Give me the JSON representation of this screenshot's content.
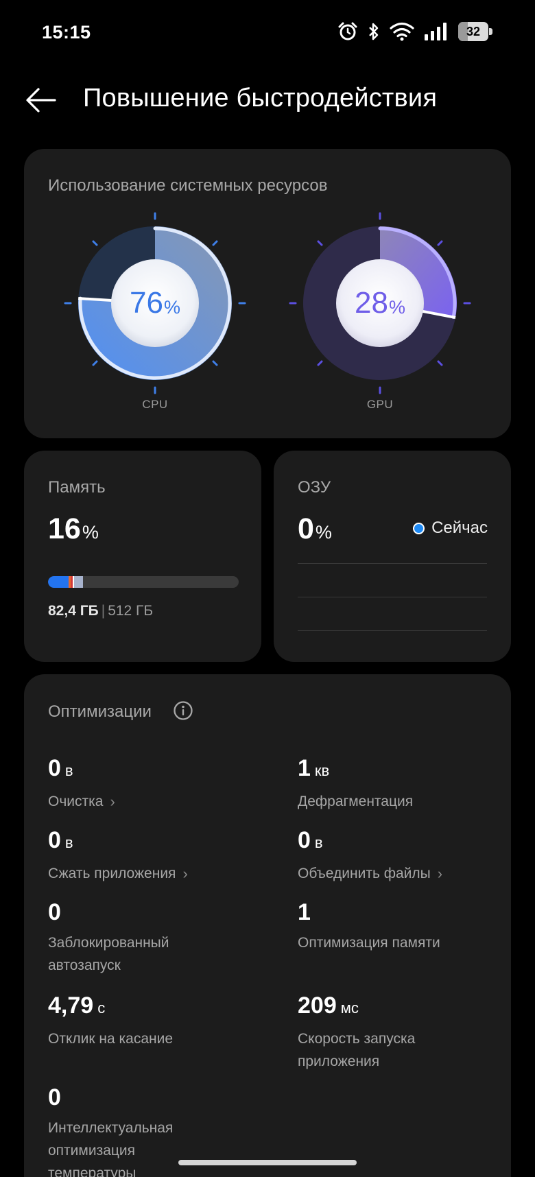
{
  "status_bar": {
    "time": "15:15",
    "battery_level": "32",
    "icons": [
      "alarm-icon",
      "bluetooth-icon",
      "wifi-icon",
      "signal-icon",
      "battery-icon"
    ]
  },
  "header": {
    "title": "Повышение быстродействия",
    "back_icon": "arrow-left-icon"
  },
  "resources": {
    "title": "Использование системных ресурсов",
    "cpu": {
      "value": "76",
      "percent_sign": "%",
      "label": "CPU",
      "fraction": 0.76,
      "accent": "#5aa0ff"
    },
    "gpu": {
      "value": "28",
      "percent_sign": "%",
      "label": "GPU",
      "fraction": 0.28,
      "accent": "#8a7bff"
    }
  },
  "memory": {
    "title": "Память",
    "value": "16",
    "percent_sign": "%",
    "used": "82,4 ГБ",
    "separator": "|",
    "total": "512 ГБ",
    "fraction": 0.16
  },
  "ram": {
    "title": "ОЗУ",
    "value": "0",
    "percent_sign": "%",
    "legend": "Сейчас"
  },
  "optimizations": {
    "title": "Оптимизации",
    "info_icon": "info-icon",
    "chevron": "›",
    "items": [
      {
        "value": "0",
        "unit": "в",
        "label": "Очистка",
        "chevron": true
      },
      {
        "value": "1",
        "unit": "кв",
        "label": "Дефрагментация",
        "chevron": false
      },
      {
        "value": "0",
        "unit": "в",
        "label": "Сжать приложения",
        "chevron": true
      },
      {
        "value": "0",
        "unit": "в",
        "label": "Объединить файлы",
        "chevron": true
      },
      {
        "value": "0",
        "unit": "",
        "label_line1": "Заблокированный",
        "label_line2": "автозапуск"
      },
      {
        "value": "1",
        "unit": "",
        "label": "Оптимизация памяти"
      },
      {
        "value": "4,79",
        "unit": "с",
        "label": "Отклик на касание"
      },
      {
        "value": "209",
        "unit": "мс",
        "label_line1": "Скорость запуска",
        "label_line2": "приложения"
      },
      {
        "value": "0",
        "unit": "",
        "label_line1": "Интеллектуальная",
        "label_line2": "оптимизация",
        "label_line3": "температуры"
      }
    ]
  }
}
